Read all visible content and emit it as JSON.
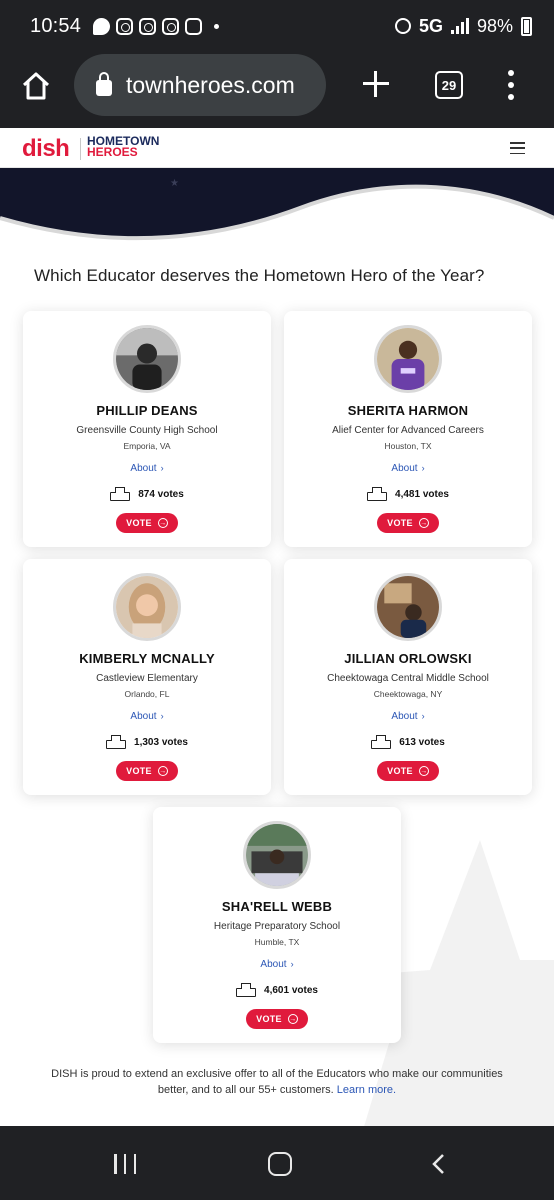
{
  "status_bar": {
    "time": "10:54",
    "network": "5G",
    "battery": "98%",
    "notification_icons": [
      "chat-bubble-icon",
      "instagram-icon",
      "instagram-icon",
      "instagram-icon",
      "slack-icon"
    ]
  },
  "browser": {
    "url": "townheroes.com",
    "tab_count": "29"
  },
  "site": {
    "brand": "dish",
    "subbrand_line1": "HOMETOWN",
    "subbrand_line2": "HEROES",
    "brand_color": "#e01a3c",
    "navy_color": "#1b2a5c"
  },
  "main": {
    "question": "Which Educator deserves the Hometown Hero of the Year?",
    "about_label": "About",
    "vote_label": "VOTE"
  },
  "candidates": [
    {
      "name": "PHILLIP DEANS",
      "school": "Greensville County High School",
      "city": "Emporia, VA",
      "votes": "874 votes"
    },
    {
      "name": "SHERITA HARMON",
      "school": "Alief Center for Advanced Careers",
      "city": "Houston, TX",
      "votes": "4,481 votes"
    },
    {
      "name": "KIMBERLY MCNALLY",
      "school": "Castleview Elementary",
      "city": "Orlando, FL",
      "votes": "1,303 votes"
    },
    {
      "name": "JILLIAN ORLOWSKI",
      "school": "Cheektowaga Central Middle School",
      "city": "Cheektowaga, NY",
      "votes": "613 votes"
    },
    {
      "name": "SHA'RELL WEBB",
      "school": "Heritage Preparatory School",
      "city": "Humble, TX",
      "votes": "4,601 votes"
    }
  ],
  "footer": {
    "text": "DISH is proud to extend an exclusive offer to all of the Educators who make our communities better, and to all our 55+ customers.",
    "link": "Learn more."
  }
}
